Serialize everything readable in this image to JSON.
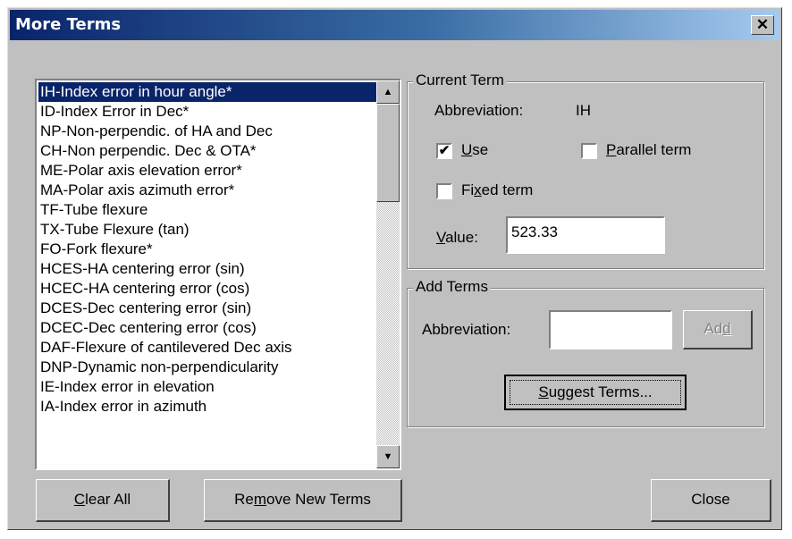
{
  "window": {
    "title": "More Terms",
    "close_glyph": "✕"
  },
  "terms_list": {
    "selected_index": 0,
    "items": [
      "IH-Index error in hour angle*",
      "ID-Index Error in Dec*",
      "NP-Non-perpendic. of HA and Dec",
      "CH-Non perpendic. Dec & OTA*",
      "ME-Polar axis elevation error*",
      "MA-Polar axis azimuth error*",
      "TF-Tube flexure",
      "TX-Tube Flexure (tan)",
      "FO-Fork flexure*",
      "HCES-HA centering error (sin)",
      "HCEC-HA centering error (cos)",
      "DCES-Dec centering error (sin)",
      "DCEC-Dec centering error (cos)",
      "DAF-Flexure of cantilevered Dec axis",
      "DNP-Dynamic non-perpendicularity",
      "IE-Index error in elevation",
      "IA-Index error in azimuth"
    ]
  },
  "current_term": {
    "legend": "Current Term",
    "abbreviation_label": "Abbreviation:",
    "abbreviation_value": "IH",
    "use": {
      "pre": "",
      "accel": "U",
      "post": "se",
      "checked": true
    },
    "parallel": {
      "pre": "",
      "accel": "P",
      "post": "arallel term",
      "checked": false
    },
    "fixed": {
      "pre": "Fi",
      "accel": "x",
      "post": "ed term",
      "checked": false
    },
    "value_label": {
      "pre": "",
      "accel": "V",
      "post": "alue:"
    },
    "value": "523.33"
  },
  "add_terms": {
    "legend": "Add Terms",
    "abbreviation_label": "Abbreviation:",
    "abbreviation_value": "",
    "add": {
      "pre": "Ad",
      "accel": "d",
      "post": ""
    },
    "suggest": {
      "pre": "",
      "accel": "S",
      "post": "uggest Terms..."
    }
  },
  "buttons": {
    "clear_all": {
      "pre": "",
      "accel": "C",
      "post": "lear All"
    },
    "remove_new": {
      "pre": "Re",
      "accel": "m",
      "post": "ove New Terms"
    },
    "close": "Close"
  },
  "colors": {
    "selection": "#0a246a",
    "face": "#c0c0c0"
  }
}
